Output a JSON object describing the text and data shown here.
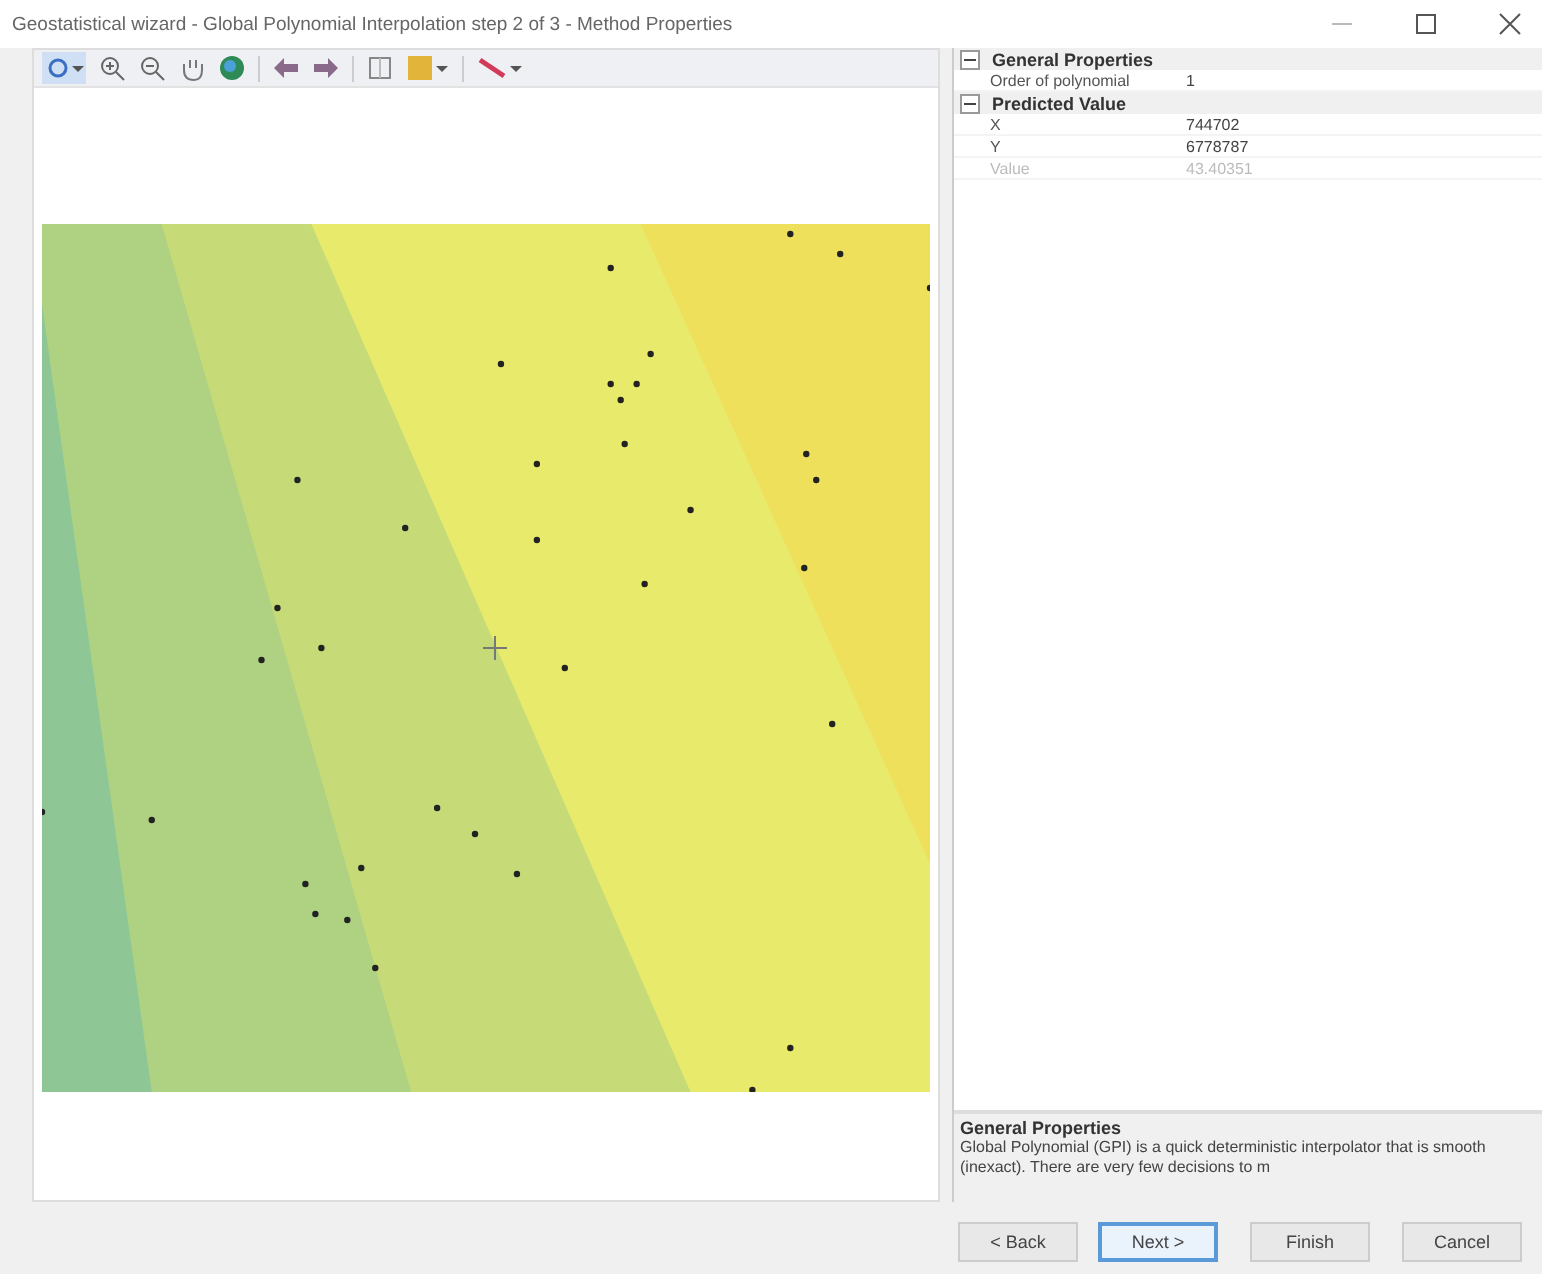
{
  "window": {
    "title": "Geostatistical wizard - Global Polynomial Interpolation step 2 of 3 - Method Properties"
  },
  "properties": {
    "groups": [
      {
        "title": "General Properties",
        "expanded": true,
        "rows": [
          {
            "name": "Order of polynomial",
            "value": "1",
            "disabled": false
          }
        ]
      },
      {
        "title": "Predicted Value",
        "expanded": true,
        "rows": [
          {
            "name": "X",
            "value": "744702",
            "disabled": false
          },
          {
            "name": "Y",
            "value": "6778787",
            "disabled": false
          },
          {
            "name": "Value",
            "value": "43.40351",
            "disabled": true
          }
        ]
      }
    ]
  },
  "description": {
    "title": "General Properties",
    "text": "Global Polynomial (GPI) is a quick deterministic interpolator that is smooth (inexact). There are very few decisions to m"
  },
  "buttons": [
    {
      "label": "< Back",
      "selected": false
    },
    {
      "label": "Next >",
      "selected": true
    },
    {
      "label": "Finish",
      "selected": false
    },
    {
      "label": "Cancel",
      "selected": false
    }
  ]
}
